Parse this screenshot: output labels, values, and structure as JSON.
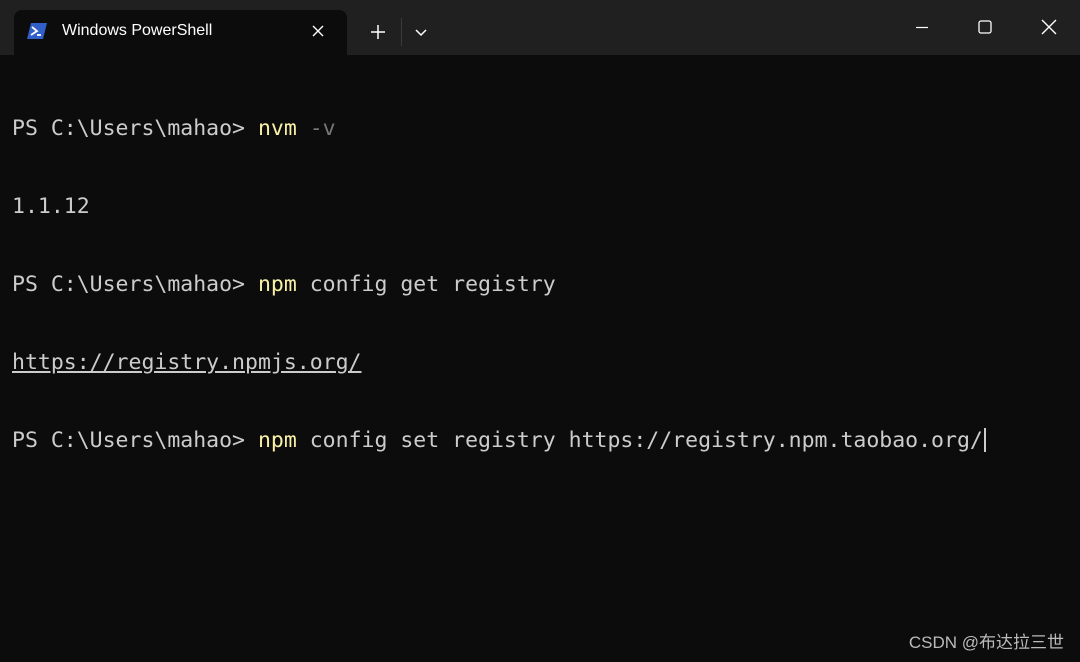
{
  "window": {
    "tab_title": "Windows PowerShell",
    "tab_icon": "powershell-icon",
    "new_tab_icon": "plus-icon",
    "dropdown_icon": "chevron-down-icon",
    "minimize_icon": "minimize-icon",
    "maximize_icon": "maximize-icon",
    "close_icon": "close-icon"
  },
  "terminal": {
    "lines": [
      {
        "prompt": "PS C:\\Users\\mahao> ",
        "command": "nvm",
        "args": " -v"
      },
      {
        "output": "1.1.12"
      },
      {
        "prompt": "PS C:\\Users\\mahao> ",
        "command": "npm",
        "args": " config get registry"
      },
      {
        "output_link": "https://registry.npmjs.org/"
      },
      {
        "prompt": "PS C:\\Users\\mahao> ",
        "command": "npm",
        "args": " config set registry https://registry.npm.taobao.org/"
      }
    ]
  },
  "watermark": "CSDN @布达拉三世",
  "colors": {
    "background": "#0c0c0c",
    "titlebar": "#202020",
    "command": "#f9f1a5",
    "text": "#cccccc",
    "dim_arg": "#767676",
    "accent_icon": "#2f5fc7"
  }
}
